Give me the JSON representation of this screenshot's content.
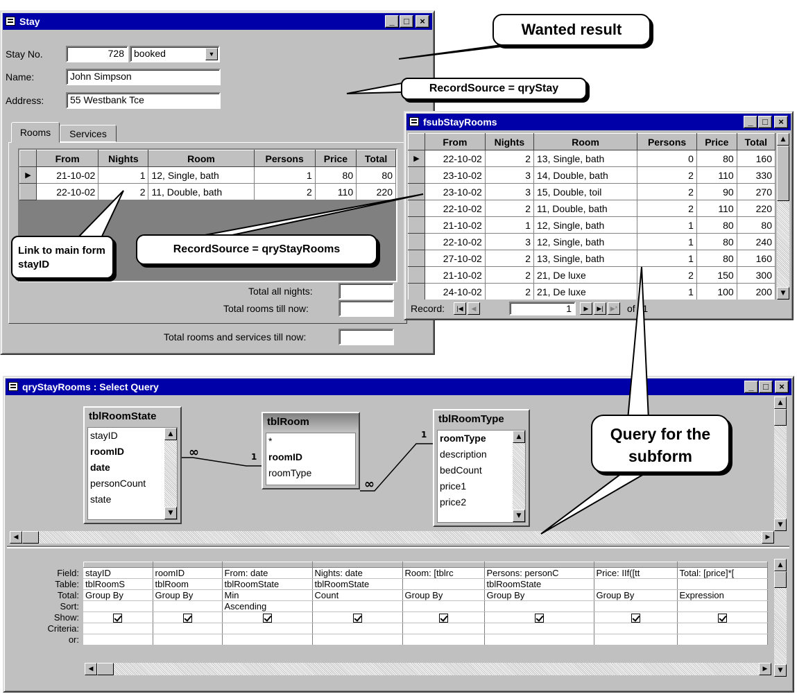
{
  "stay_window": {
    "title": "Stay",
    "stay_no_label": "Stay No.",
    "stay_no_value": "728",
    "status_value": "booked",
    "name_label": "Name:",
    "name_value": "John Simpson",
    "address_label": "Address:",
    "address_value": "55 Westbank Tce",
    "tabs": [
      "Rooms",
      "Services"
    ],
    "columns": [
      "From",
      "Nights",
      "Room",
      "Persons",
      "Price",
      "Total"
    ],
    "rows": [
      [
        "21-10-02",
        "1",
        "12, Single, bath",
        "1",
        "80",
        "80"
      ],
      [
        "22-10-02",
        "2",
        "11, Double, bath",
        "2",
        "110",
        "220"
      ]
    ],
    "total_all_nights_label": "Total all nights:",
    "total_rooms_label": "Total rooms till now:",
    "total_rooms_services_label": "Total rooms and services till now:"
  },
  "subform_window": {
    "title": "fsubStayRooms",
    "columns": [
      "From",
      "Nights",
      "Room",
      "Persons",
      "Price",
      "Total"
    ],
    "rows": [
      [
        "22-10-02",
        "2",
        "13, Single, bath",
        "0",
        "80",
        "160"
      ],
      [
        "23-10-02",
        "3",
        "14, Double, bath",
        "2",
        "110",
        "330"
      ],
      [
        "23-10-02",
        "3",
        "15, Double, toil",
        "2",
        "90",
        "270"
      ],
      [
        "22-10-02",
        "2",
        "11, Double, bath",
        "2",
        "110",
        "220"
      ],
      [
        "21-10-02",
        "1",
        "12, Single, bath",
        "1",
        "80",
        "80"
      ],
      [
        "22-10-02",
        "3",
        "12, Single, bath",
        "1",
        "80",
        "240"
      ],
      [
        "27-10-02",
        "2",
        "13, Single, bath",
        "1",
        "80",
        "160"
      ],
      [
        "21-10-02",
        "2",
        "21, De luxe",
        "2",
        "150",
        "300"
      ],
      [
        "24-10-02",
        "2",
        "21, De luxe",
        "1",
        "100",
        "200"
      ]
    ],
    "record_label": "Record:",
    "record_value": "1",
    "record_of": "of 11"
  },
  "query_window": {
    "title": "qryStayRooms : Select Query",
    "tables": [
      {
        "name": "tblRoomState",
        "fields": [
          "stayID",
          "roomID",
          "date",
          "personCount",
          "state"
        ],
        "bold": [
          "roomID",
          "date"
        ]
      },
      {
        "name": "tblRoom",
        "fields": [
          "*",
          "roomID",
          "roomType"
        ],
        "bold": [
          "roomID"
        ]
      },
      {
        "name": "tblRoomType",
        "fields": [
          "roomType",
          "description",
          "bedCount",
          "price1",
          "price2"
        ],
        "bold": [
          "roomType"
        ]
      }
    ],
    "join_labels": {
      "many": "∞",
      "one": "1"
    },
    "row_labels": [
      "Field:",
      "Table:",
      "Total:",
      "Sort:",
      "Show:",
      "Criteria:",
      "or:"
    ],
    "columns": [
      {
        "field": "stayID",
        "table": "tblRoomS",
        "total": "Group By",
        "sort": ""
      },
      {
        "field": "roomID",
        "table": "tblRoom",
        "total": "Group By",
        "sort": ""
      },
      {
        "field": "From: date",
        "table": "tblRoomState",
        "total": "Min",
        "sort": "Ascending"
      },
      {
        "field": "Nights: date",
        "table": "tblRoomState",
        "total": "Count",
        "sort": ""
      },
      {
        "field": "Room: [tblrc",
        "table": "",
        "total": "Group By",
        "sort": ""
      },
      {
        "field": "Persons: personC",
        "table": "tblRoomState",
        "total": "Group By",
        "sort": ""
      },
      {
        "field": "Price: IIf([tt",
        "table": "",
        "total": "Group By",
        "sort": ""
      },
      {
        "field": "Total: [price]*[",
        "table": "",
        "total": "Expression",
        "sort": ""
      }
    ]
  },
  "callouts": {
    "wanted": "Wanted result",
    "recordsource_stay": "RecordSource = qryStay",
    "link": "Link to main form stayID",
    "recordsource_rooms": "RecordSource = qryStayRooms",
    "query_for": "Query for the subform"
  }
}
